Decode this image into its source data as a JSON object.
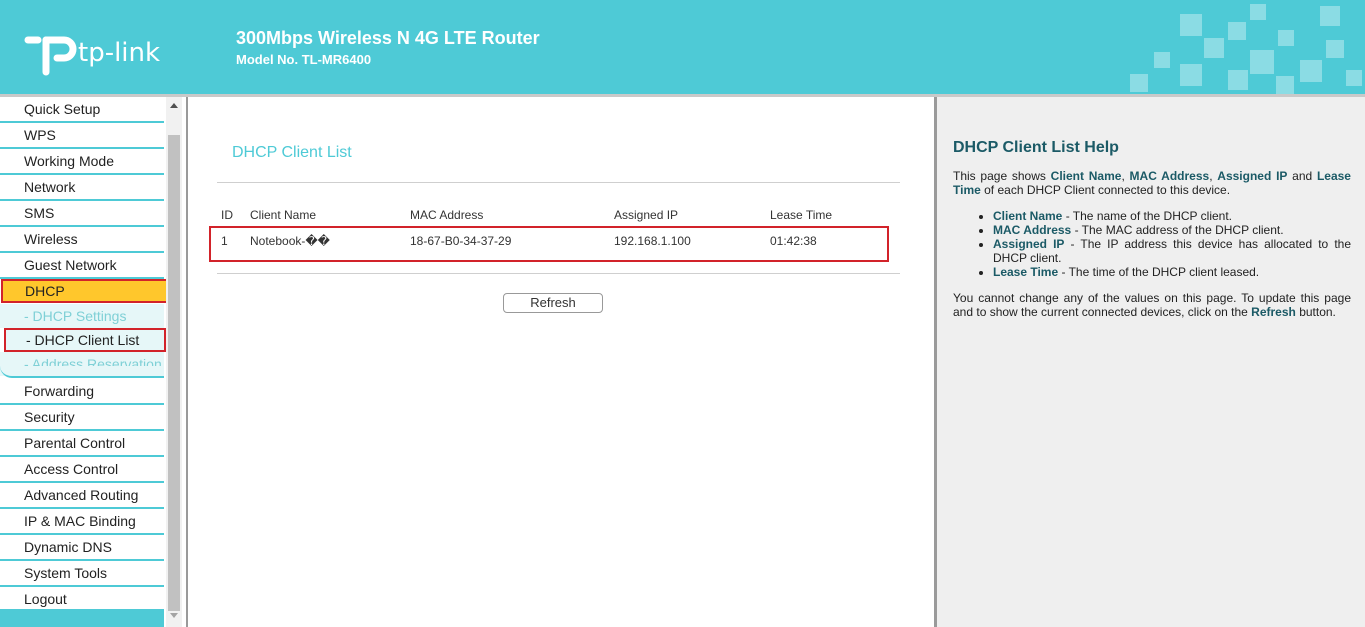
{
  "header": {
    "logo_text": "tp-link",
    "title": "300Mbps Wireless N 4G LTE Router",
    "model": "Model No. TL-MR6400",
    "colors": {
      "banner": "#4ecad6",
      "highlight_border": "#d2232a",
      "active_menu": "#ffc72c"
    }
  },
  "sidebar": {
    "items": [
      {
        "label": "Quick Setup"
      },
      {
        "label": "WPS"
      },
      {
        "label": "Working Mode"
      },
      {
        "label": "Network"
      },
      {
        "label": "SMS"
      },
      {
        "label": "Wireless"
      },
      {
        "label": "Guest Network"
      },
      {
        "label": "DHCP"
      },
      {
        "label": "Forwarding"
      },
      {
        "label": "Security"
      },
      {
        "label": "Parental Control"
      },
      {
        "label": "Access Control"
      },
      {
        "label": "Advanced Routing"
      },
      {
        "label": "IP & MAC Binding"
      },
      {
        "label": "Dynamic DNS"
      },
      {
        "label": "System Tools"
      },
      {
        "label": "Logout"
      }
    ],
    "sub_items": [
      {
        "label": "- DHCP Settings"
      },
      {
        "label": "- DHCP Client List"
      },
      {
        "label": "- Address Reservation"
      }
    ],
    "active_item": "DHCP",
    "active_sub_item": "- DHCP Client List"
  },
  "main": {
    "title": "DHCP Client List",
    "columns": [
      "ID",
      "Client Name",
      "MAC Address",
      "Assigned IP",
      "Lease Time"
    ],
    "rows": [
      [
        "1",
        "Notebook-��",
        "18-67-B0-34-37-29",
        "192.168.1.100",
        "01:42:38"
      ]
    ],
    "refresh_label": "Refresh"
  },
  "help": {
    "title": "DHCP Client List Help",
    "intro": {
      "t1": "This page shows ",
      "b1": "Client Name",
      "t2": ", ",
      "b2": "MAC Address",
      "t3": ", ",
      "b3": "Assigned IP",
      "t4": " and ",
      "b4": "Lease Time",
      "t5": " of each DHCP Client connected to this device."
    },
    "bullets": [
      {
        "term": "Client Name",
        "desc": " - The name of the DHCP client."
      },
      {
        "term": "MAC Address",
        "desc": " - The MAC address of the DHCP client."
      },
      {
        "term": "Assigned IP",
        "desc": " - The IP address this device has allocated to the DHCP client."
      },
      {
        "term": "Lease Time",
        "desc": " - The time of the DHCP client leased."
      }
    ],
    "footer": {
      "t1": "You cannot change any of the values on this page. To update this page and to show the current connected devices, click on the ",
      "b1": "Refresh",
      "t2": " button."
    }
  }
}
